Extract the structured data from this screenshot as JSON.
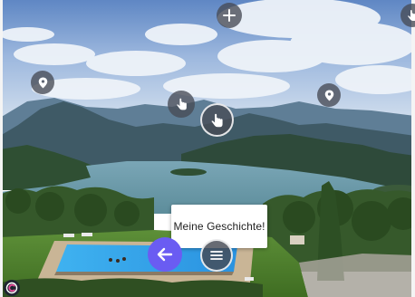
{
  "tooltip": {
    "text": "Meine Geschichte!"
  },
  "icons": {
    "add": "plus-icon",
    "top_right": "touch-hand-icon",
    "pin_left": "location-pin-icon",
    "pin_right": "location-pin-icon",
    "hand_small": "touch-hand-icon",
    "hand_large": "touch-hand-icon",
    "back": "arrow-left-icon",
    "menu": "menu-icon",
    "logo": "app-logo-icon"
  },
  "colors": {
    "hotspot": "#464a54",
    "back_button": "#6a5cf2",
    "tooltip_bg": "#ffffff"
  }
}
